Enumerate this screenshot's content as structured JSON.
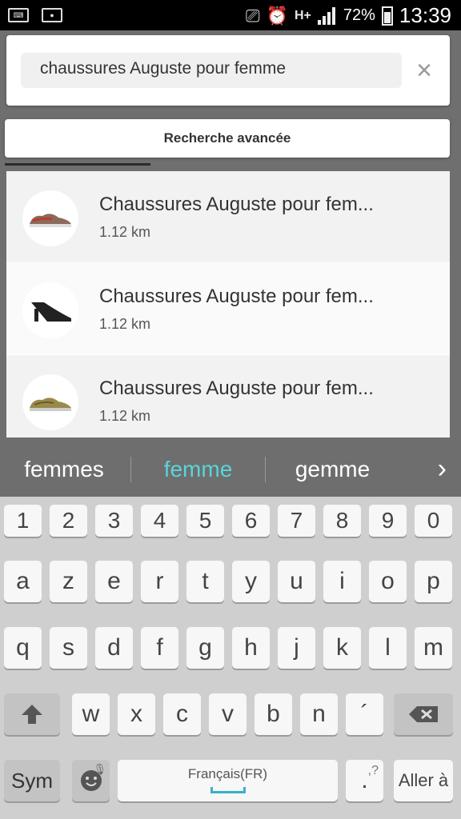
{
  "status_bar": {
    "left_icons": [
      "keyboard-icon",
      "screen-record-icon"
    ],
    "right_icons": [
      "cast-icon",
      "alarm-icon",
      "hplus-data-icon",
      "signal-icon",
      "battery-icon"
    ],
    "network": "H+",
    "battery": "72%",
    "time": "13:39"
  },
  "search": {
    "value": "chaussures Auguste pour femme",
    "clear_symbol": "×"
  },
  "advanced_search_label": "Recherche avancée",
  "suggestions": [
    {
      "title": "Chaussures Auguste pour fem...",
      "distance": "1.12 km",
      "thumb": "sneaker-red"
    },
    {
      "title": "Chaussures Auguste pour fem...",
      "distance": "1.12 km",
      "thumb": "mule-black"
    },
    {
      "title": "Chaussures Auguste pour fem...",
      "distance": "1.12 km",
      "thumb": "sneaker-gold"
    }
  ],
  "keyboard": {
    "predictions": [
      "femmes",
      "femme",
      "gemme"
    ],
    "selected_prediction": "femme",
    "more_symbol": "›",
    "numbers": [
      "1",
      "2",
      "3",
      "4",
      "5",
      "6",
      "7",
      "8",
      "9",
      "0"
    ],
    "row1": [
      "a",
      "z",
      "e",
      "r",
      "t",
      "y",
      "u",
      "i",
      "o",
      "p"
    ],
    "row2": [
      "q",
      "s",
      "d",
      "f",
      "g",
      "h",
      "j",
      "k",
      "l",
      "m"
    ],
    "row3": [
      "w",
      "x",
      "c",
      "v",
      "b",
      "n",
      "´"
    ],
    "sym_label": "Sym",
    "space_label": "Français(FR)",
    "punct_label": ".",
    "punct_hint": ",?",
    "enter_label": "Aller à"
  },
  "colors": {
    "prediction_selected": "#5ad4d8",
    "keyboard_bg": "#cfcfcf"
  }
}
